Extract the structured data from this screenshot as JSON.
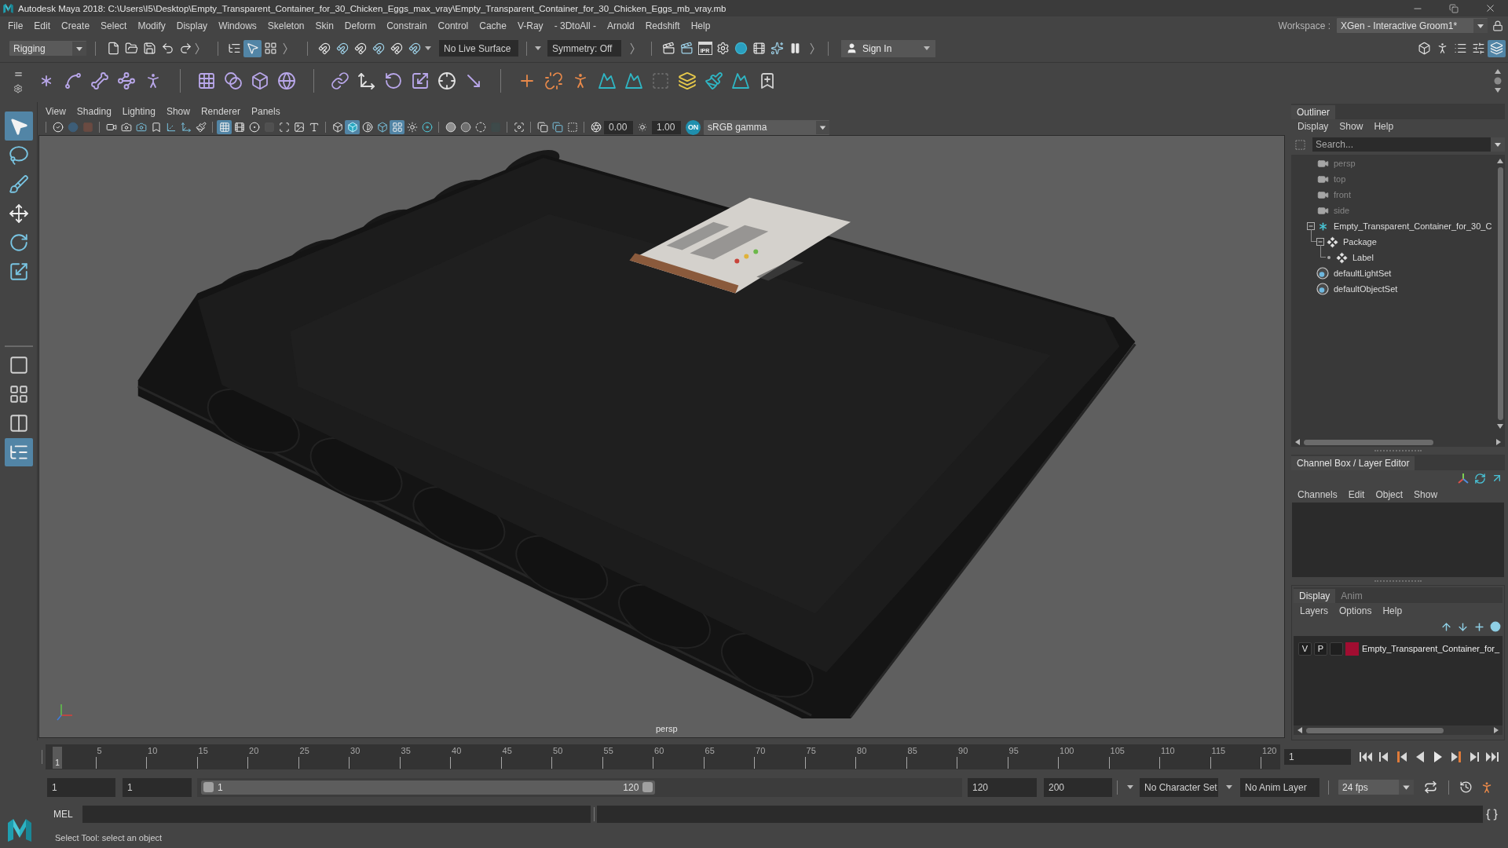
{
  "title_bar": {
    "title": "Autodesk Maya 2018: C:\\Users\\I5\\Desktop\\Empty_Transparent_Container_for_30_Chicken_Eggs_max_vray\\Empty_Transparent_Container_for_30_Chicken_Eggs_mb_vray.mb"
  },
  "menu_bar": {
    "items": [
      "File",
      "Edit",
      "Create",
      "Select",
      "Modify",
      "Display",
      "Windows",
      "Skeleton",
      "Skin",
      "Deform",
      "Constrain",
      "Control",
      "Cache",
      "V-Ray",
      "- 3DtoAll -",
      "Arnold",
      "Redshift",
      "Help"
    ],
    "workspace_label": "Workspace :",
    "workspace": "XGen - Interactive Groom1*"
  },
  "status_line": {
    "menu_set": "Rigging",
    "selection_masks": [
      {
        "kind": "hierarchy",
        "selected": false
      },
      {
        "kind": "object",
        "selected": true
      },
      {
        "kind": "component",
        "selected": false
      }
    ],
    "live_surface": "No Live Surface",
    "symmetry": "Symmetry: Off",
    "ipr": "IPR",
    "sign_in": "Sign In",
    "panel_toggles": [
      {
        "kind": "modeling-toolkit",
        "selected": false
      },
      {
        "kind": "character-controls",
        "selected": false
      },
      {
        "kind": "attribute-editor",
        "selected": false
      },
      {
        "kind": "tool-settings",
        "selected": false
      },
      {
        "kind": "channel-box",
        "selected": true
      }
    ]
  },
  "toolbox": {
    "tools": [
      {
        "kind": "select",
        "selected": true
      },
      {
        "kind": "lasso",
        "selected": false
      },
      {
        "kind": "paint",
        "selected": false
      },
      {
        "kind": "move",
        "selected": false
      },
      {
        "kind": "rotate",
        "selected": false
      },
      {
        "kind": "scale",
        "selected": false
      }
    ],
    "layouts": [
      {
        "kind": "single",
        "selected": false
      },
      {
        "kind": "four",
        "selected": false
      },
      {
        "kind": "two",
        "selected": false
      },
      {
        "kind": "outliner",
        "selected": true
      }
    ]
  },
  "viewport": {
    "menus": [
      "View",
      "Shading",
      "Lighting",
      "Show",
      "Renderer",
      "Panels"
    ],
    "toolbar": [
      [
        {
          "kind": "select-camera",
          "selected": false
        },
        {
          "kind": "camera-lock",
          "selected": false
        },
        {
          "kind": "camera-bookmark",
          "selected": false
        }
      ],
      [
        {
          "kind": "camera-attributes",
          "selected": false
        },
        {
          "kind": "image-plane",
          "selected": false
        },
        {
          "kind": "camera-tools",
          "selected": false
        },
        {
          "kind": "bookmark",
          "selected": false
        },
        {
          "kind": "pan-zoom",
          "selected": false
        },
        {
          "kind": "two-d-pan",
          "selected": false
        },
        {
          "kind": "grease-pencil",
          "selected": false
        }
      ],
      [
        {
          "kind": "grid",
          "selected": true
        },
        {
          "kind": "film-gate",
          "selected": false
        },
        {
          "kind": "resolution-gate",
          "selected": false
        },
        {
          "kind": "gate-mask",
          "selected": false
        },
        {
          "kind": "field-chart",
          "selected": false
        },
        {
          "kind": "safe-action",
          "selected": false
        },
        {
          "kind": "safe-title",
          "selected": false
        }
      ],
      [
        {
          "kind": "wireframe",
          "selected": false
        },
        {
          "kind": "smooth-shade",
          "selected": true
        },
        {
          "kind": "default-material",
          "selected": false
        },
        {
          "kind": "wire-on-shaded",
          "selected": false
        },
        {
          "kind": "textured",
          "selected": true
        },
        {
          "kind": "lights",
          "selected": false
        },
        {
          "kind": "shadows",
          "selected": false
        }
      ],
      [
        {
          "kind": "ambient-occlusion",
          "selected": false
        },
        {
          "kind": "motion-blur",
          "selected": false
        },
        {
          "kind": "anti-aliasing",
          "selected": false
        },
        {
          "kind": "depth-of-field",
          "selected": false
        }
      ],
      [
        {
          "kind": "isolate",
          "selected": false
        }
      ],
      [
        {
          "kind": "xray",
          "selected": false
        },
        {
          "kind": "xray-active",
          "selected": false
        },
        {
          "kind": "xray-joints",
          "selected": false
        }
      ]
    ],
    "exposure": "0.00",
    "gamma": "1.00",
    "color_management": "ON",
    "view_transform": "sRGB gamma",
    "camera": "persp"
  },
  "outliner": {
    "title": "Outliner",
    "menus": [
      "Display",
      "Show",
      "Help"
    ],
    "search_placeholder": "Search...",
    "items": [
      {
        "kind": "camera",
        "label": "persp",
        "hidden": true
      },
      {
        "kind": "camera",
        "label": "top",
        "hidden": true
      },
      {
        "kind": "camera",
        "label": "front",
        "hidden": true
      },
      {
        "kind": "camera",
        "label": "side",
        "hidden": true
      },
      {
        "kind": "transform",
        "label": "Empty_Transparent_Container_for_30_C",
        "hidden": false,
        "expanded": true,
        "children": [
          {
            "kind": "mesh",
            "label": "Package",
            "hidden": false,
            "expanded": true,
            "children": [
              {
                "kind": "mesh",
                "label": "Label",
                "hidden": false
              }
            ]
          }
        ]
      },
      {
        "kind": "set",
        "label": "defaultLightSet",
        "hidden": false
      },
      {
        "kind": "set",
        "label": "defaultObjectSet",
        "hidden": false
      }
    ]
  },
  "channel_box": {
    "title": "Channel Box / Layer Editor",
    "menus": [
      "Channels",
      "Edit",
      "Object",
      "Show"
    ]
  },
  "layer_editor": {
    "tabs": [
      {
        "label": "Display",
        "selected": true
      },
      {
        "label": "Anim",
        "selected": false
      }
    ],
    "menus": [
      "Layers",
      "Options",
      "Help"
    ],
    "layers": [
      {
        "visibility": "V",
        "playback": "P",
        "name": "Empty_Transparent_Container_for_",
        "color": "#a10d31"
      }
    ]
  },
  "time_slider": {
    "ticks": [
      "5",
      "10",
      "15",
      "20",
      "25",
      "30",
      "35",
      "40",
      "45",
      "50",
      "55",
      "60",
      "65",
      "70",
      "75",
      "80",
      "85",
      "90",
      "95",
      "100",
      "105",
      "110",
      "115",
      "120"
    ],
    "playhead": "1",
    "level": 0,
    "current_frame": "1"
  },
  "range_slider": {
    "start": "1",
    "playback_start": "1",
    "range_start": "1",
    "range_end": "120",
    "level": 0.6,
    "playback_end": "120",
    "end": "200",
    "character_set": "No Character Set",
    "anim_layer": "No Anim Layer",
    "fps": "24 fps"
  },
  "command_line": {
    "language": "MEL"
  },
  "help_line": "Select Tool: select an object"
}
